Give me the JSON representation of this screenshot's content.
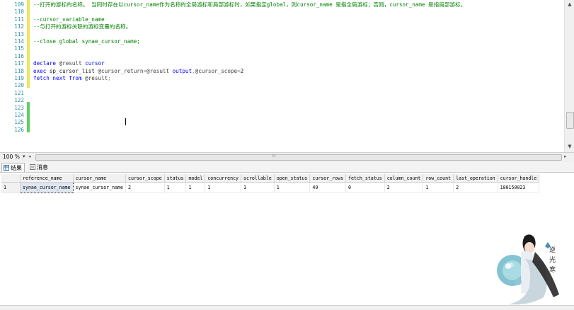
{
  "editor": {
    "lines": [
      {
        "num": "109",
        "parts": [
          {
            "t": "--打开的游标的名称。 当同时存在以cursor_name作为名称的全局游标和局部游标时，如果指定global，则cursor_name 是指全局游标；否则，cursor_name 是指局部游标。",
            "c": "cm"
          }
        ]
      },
      {
        "num": "110",
        "parts": []
      },
      {
        "num": "111",
        "parts": [
          {
            "t": "--cursor_variable_name",
            "c": "cm"
          }
        ]
      },
      {
        "num": "112",
        "parts": [
          {
            "t": "--与打开的游标关联的游标变量的名称。",
            "c": "cm"
          }
        ]
      },
      {
        "num": "113",
        "parts": []
      },
      {
        "num": "114",
        "parts": [
          {
            "t": "--close global synae_cursor_name;",
            "c": "cm"
          }
        ]
      },
      {
        "num": "115",
        "parts": []
      },
      {
        "num": "116",
        "parts": []
      },
      {
        "num": "117",
        "parts": [
          {
            "t": "declare ",
            "c": "kw"
          },
          {
            "t": "@result ",
            "c": "vr"
          },
          {
            "t": "cursor",
            "c": "kw"
          }
        ]
      },
      {
        "num": "118",
        "parts": [
          {
            "t": "exec ",
            "c": "kw"
          },
          {
            "t": "sp_cursor_list ",
            "c": "txt"
          },
          {
            "t": "@cursor_return",
            "c": "vr"
          },
          {
            "t": "=",
            "c": "sym"
          },
          {
            "t": "@result ",
            "c": "vr"
          },
          {
            "t": "output",
            "c": "kw"
          },
          {
            "t": ",",
            "c": "sym"
          },
          {
            "t": "@cursor_scope",
            "c": "vr"
          },
          {
            "t": "=",
            "c": "sym"
          },
          {
            "t": "2",
            "c": "txt"
          }
        ]
      },
      {
        "num": "119",
        "parts": [
          {
            "t": "fetch next from ",
            "c": "kw"
          },
          {
            "t": "@result",
            "c": "vr"
          },
          {
            "t": ";",
            "c": "sym"
          }
        ]
      },
      {
        "num": "120",
        "parts": []
      },
      {
        "num": "121",
        "parts": []
      },
      {
        "num": "122",
        "parts": []
      },
      {
        "num": "123",
        "parts": []
      },
      {
        "num": "124",
        "parts": []
      },
      {
        "num": "125",
        "parts": []
      },
      {
        "num": "126",
        "parts": []
      }
    ]
  },
  "zoom": {
    "value": "100 %"
  },
  "tabs": [
    {
      "label": "结果",
      "active": true
    },
    {
      "label": "消息",
      "active": false
    }
  ],
  "grid": {
    "columns": [
      "reference_name",
      "cursor_name",
      "cursor_scope",
      "status",
      "model",
      "concurrency",
      "scrollable",
      "open_status",
      "cursor_rows",
      "fetch_status",
      "column_count",
      "row_count",
      "last_operation",
      "cursor_handle"
    ],
    "rows": [
      {
        "num": "1",
        "cells": [
          "synae_cursor_name",
          "synae_cursor_name",
          "2",
          "1",
          "1",
          "1",
          "1",
          "1",
          "49",
          "0",
          "2",
          "1",
          "2",
          "180150023"
        ]
      }
    ]
  },
  "colors": {
    "keyword": "#0000ff",
    "comment": "#008000",
    "line_number": "#2b91af",
    "change_green": "#5fd35f",
    "change_yellow": "#f2e35c"
  }
}
